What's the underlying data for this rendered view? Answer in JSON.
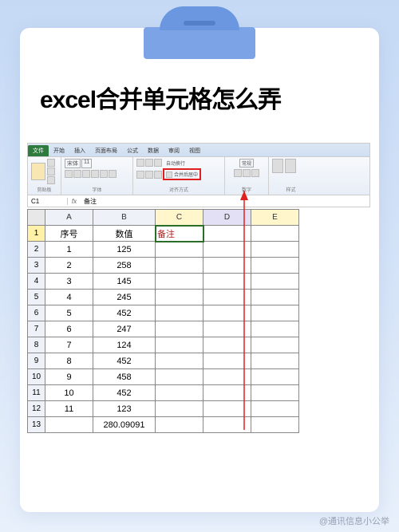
{
  "title": "excel合并单元格怎么弄",
  "ribbon": {
    "tabs": [
      "文件",
      "开始",
      "插入",
      "页面布局",
      "公式",
      "数据",
      "审阅",
      "视图"
    ],
    "active_tab": "文件",
    "groups": {
      "clipboard": {
        "label": "剪贴板",
        "paste": "粘贴"
      },
      "font": {
        "label": "字体",
        "name": "宋体",
        "size": "11"
      },
      "align": {
        "label": "对齐方式",
        "wrap": "自动换行",
        "merge": "合并后居中"
      },
      "number": {
        "label": "数字",
        "format": "常规"
      },
      "styles": {
        "label": "样式",
        "cond": "条件格式",
        "cell": "套用表格格式"
      }
    }
  },
  "namebox": "C1",
  "formula_value": "备注",
  "col_headers": [
    "A",
    "B",
    "C",
    "D",
    "E"
  ],
  "header_row": {
    "A": "序号",
    "B": "数值",
    "C": "备注"
  },
  "chart_data": {
    "type": "table",
    "columns": [
      "序号",
      "数值"
    ],
    "rows": [
      [
        1,
        125
      ],
      [
        2,
        258
      ],
      [
        3,
        145
      ],
      [
        4,
        245
      ],
      [
        5,
        452
      ],
      [
        6,
        247
      ],
      [
        7,
        124
      ],
      [
        8,
        452
      ],
      [
        9,
        458
      ],
      [
        10,
        452
      ],
      [
        11,
        123
      ]
    ],
    "footer_B": 280.09091
  },
  "watermark": "@通讯信息小公举"
}
